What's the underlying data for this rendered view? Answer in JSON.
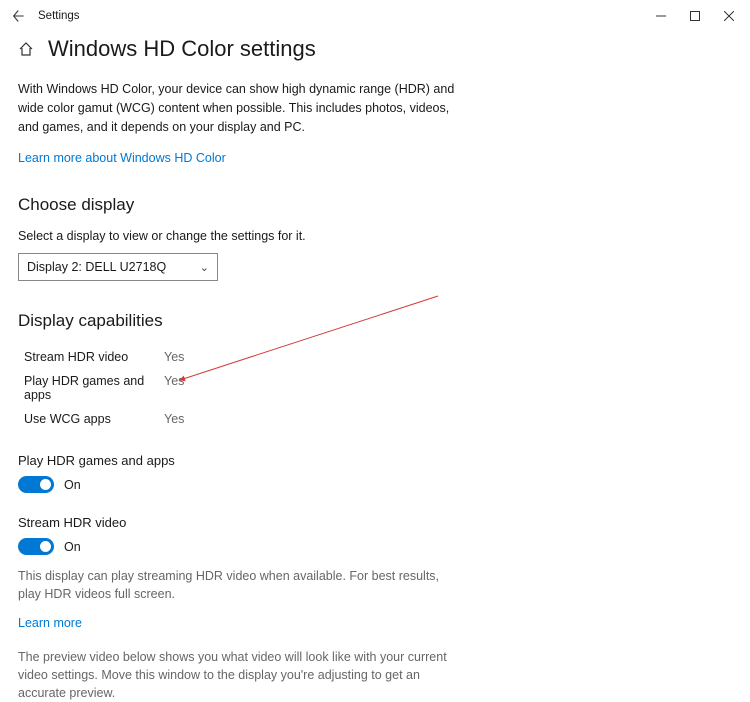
{
  "titlebar": {
    "title": "Settings"
  },
  "page": {
    "title": "Windows HD Color settings",
    "intro": "With Windows HD Color, your device can show high dynamic range (HDR) and wide color gamut (WCG) content when possible. This includes photos, videos, and games, and it depends on your display and PC.",
    "learnMoreLink": "Learn more about Windows HD Color"
  },
  "chooseDisplay": {
    "heading": "Choose display",
    "subtext": "Select a display to view or change the settings for it.",
    "selected": "Display 2: DELL U2718Q"
  },
  "capabilities": {
    "heading": "Display capabilities",
    "rows": [
      {
        "label": "Stream HDR video",
        "value": "Yes"
      },
      {
        "label": "Play HDR games and apps",
        "value": "Yes"
      },
      {
        "label": "Use WCG apps",
        "value": "Yes"
      }
    ]
  },
  "playHdr": {
    "label": "Play HDR games and apps",
    "state": "On"
  },
  "streamHdr": {
    "label": "Stream HDR video",
    "state": "On",
    "desc": "This display can play streaming HDR video when available. For best results, play HDR videos full screen.",
    "learnMore": "Learn more"
  },
  "preview": {
    "desc": "The preview video below shows you what video will look like with your current video settings. Move this window to the display you're adjusting to get an accurate preview."
  }
}
